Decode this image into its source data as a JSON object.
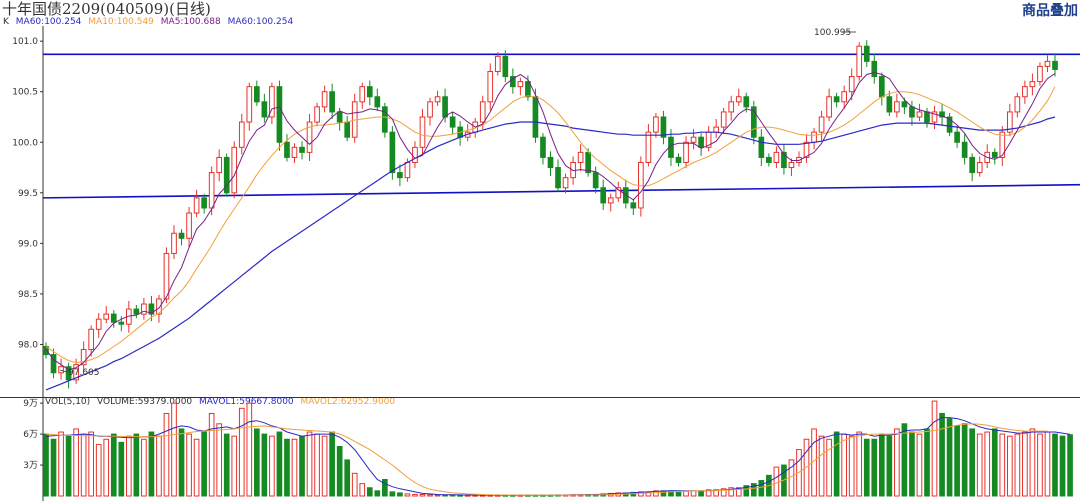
{
  "window": {
    "title": "十年国债2209(040509)(日线)",
    "brand": "商品叠加"
  },
  "colors": {
    "up": "#e8322b",
    "down": "#168a22",
    "ma5": "#7a1e8c",
    "ma10": "#f2a03a",
    "ma60": "#2a2ac8",
    "trendline": "#1010c8",
    "axis": "#333333",
    "grid": "#cccccc"
  },
  "legend": {
    "price": [
      {
        "text": "K",
        "color": "#333333"
      },
      {
        "text": "MA60:100.254",
        "color": "#2a2ac8"
      },
      {
        "text": "MA10:100.549",
        "color": "#f2a03a"
      },
      {
        "text": "MA5:100.688",
        "color": "#7a1e8c"
      },
      {
        "text": "MA60:100.254",
        "color": "#2a2ac8"
      }
    ],
    "volume": [
      {
        "text": "VOL(5,10)",
        "color": "#333333"
      },
      {
        "text": "VOLUME:59379.0000",
        "color": "#333333"
      },
      {
        "text": "MAVOL1:59667.8000",
        "color": "#2a2ac8"
      },
      {
        "text": "MAVOL2:62952.9000",
        "color": "#f2a03a"
      }
    ]
  },
  "annotations": {
    "high": "100.995",
    "low": "97.605"
  },
  "chart_data": [
    {
      "type": "candlestick",
      "ylim": [
        97.5,
        101.15
      ],
      "yticks": [
        "101.0",
        "100.5",
        "100.0",
        "99.5",
        "99.0",
        "98.5",
        "98.0"
      ],
      "ytick_values": [
        101.0,
        100.5,
        100.0,
        99.5,
        99.0,
        98.5,
        98.0
      ],
      "grid": false,
      "trendlines": [
        {
          "start": 100.87,
          "end": 100.87
        },
        {
          "start": 99.45,
          "end": 99.58
        }
      ],
      "close": [
        97.9,
        97.72,
        97.78,
        97.65,
        97.8,
        97.95,
        98.15,
        98.25,
        98.3,
        98.22,
        98.2,
        98.35,
        98.3,
        98.4,
        98.3,
        98.45,
        98.9,
        99.1,
        99.05,
        99.3,
        99.45,
        99.35,
        99.7,
        99.85,
        99.5,
        99.95,
        100.2,
        100.55,
        100.4,
        100.25,
        100.55,
        100.0,
        99.85,
        99.95,
        99.9,
        100.2,
        100.35,
        100.5,
        100.3,
        100.2,
        100.05,
        100.4,
        100.55,
        100.45,
        100.35,
        100.1,
        99.7,
        99.65,
        99.8,
        99.95,
        100.25,
        100.4,
        100.45,
        100.25,
        100.15,
        100.05,
        100.1,
        100.2,
        100.4,
        100.7,
        100.85,
        100.65,
        100.55,
        100.6,
        100.45,
        100.05,
        99.85,
        99.75,
        99.55,
        99.65,
        99.8,
        99.9,
        99.7,
        99.55,
        99.4,
        99.45,
        99.55,
        99.4,
        99.35,
        99.8,
        100.1,
        100.25,
        100.05,
        99.85,
        99.8,
        100.0,
        100.05,
        99.95,
        100.1,
        100.15,
        100.3,
        100.4,
        100.45,
        100.35,
        100.05,
        99.85,
        99.8,
        99.9,
        99.75,
        99.8,
        99.85,
        100.0,
        100.1,
        100.25,
        100.45,
        100.4,
        100.5,
        100.65,
        100.95,
        100.8,
        100.65,
        100.45,
        100.3,
        100.4,
        100.35,
        100.25,
        100.3,
        100.2,
        100.3,
        100.25,
        100.1,
        100.0,
        99.85,
        99.7,
        99.8,
        99.9,
        99.85,
        100.1,
        100.3,
        100.45,
        100.55,
        100.6,
        100.75,
        100.8,
        100.72
      ],
      "open": [
        97.98,
        97.9,
        97.72,
        97.78,
        97.65,
        97.8,
        97.95,
        98.15,
        98.25,
        98.3,
        98.22,
        98.2,
        98.35,
        98.3,
        98.4,
        98.3,
        98.45,
        98.9,
        99.1,
        99.05,
        99.3,
        99.45,
        99.35,
        99.7,
        99.85,
        99.5,
        99.95,
        100.2,
        100.55,
        100.4,
        100.25,
        100.55,
        100.0,
        99.85,
        99.95,
        99.9,
        100.2,
        100.35,
        100.5,
        100.3,
        100.2,
        100.05,
        100.4,
        100.55,
        100.45,
        100.35,
        100.1,
        99.7,
        99.65,
        99.8,
        99.95,
        100.25,
        100.4,
        100.45,
        100.25,
        100.15,
        100.05,
        100.1,
        100.2,
        100.4,
        100.7,
        100.85,
        100.65,
        100.55,
        100.6,
        100.45,
        100.05,
        99.85,
        99.75,
        99.55,
        99.65,
        99.8,
        99.9,
        99.7,
        99.55,
        99.4,
        99.45,
        99.55,
        99.4,
        99.35,
        99.8,
        100.1,
        100.25,
        100.05,
        99.85,
        99.8,
        100.0,
        100.05,
        99.95,
        100.1,
        100.15,
        100.3,
        100.4,
        100.45,
        100.35,
        100.05,
        99.85,
        99.8,
        99.9,
        99.75,
        99.8,
        99.85,
        100.0,
        100.1,
        100.25,
        100.45,
        100.4,
        100.5,
        100.65,
        100.95,
        100.8,
        100.65,
        100.45,
        100.3,
        100.4,
        100.35,
        100.25,
        100.3,
        100.2,
        100.3,
        100.25,
        100.1,
        100.0,
        99.85,
        99.7,
        99.8,
        99.9,
        99.85,
        100.1,
        100.3,
        100.45,
        100.55,
        100.6,
        100.75,
        100.8
      ],
      "ma5": [
        97.95,
        97.85,
        97.8,
        97.75,
        97.77,
        97.82,
        97.91,
        98.0,
        98.13,
        98.21,
        98.25,
        98.28,
        98.29,
        98.33,
        98.31,
        98.36,
        98.47,
        98.63,
        98.76,
        98.96,
        99.14,
        99.22,
        99.34,
        99.49,
        99.57,
        99.67,
        99.85,
        100.01,
        100.12,
        100.17,
        100.33,
        100.35,
        100.21,
        100.12,
        100.05,
        99.98,
        100.05,
        100.18,
        100.25,
        100.31,
        100.28,
        100.29,
        100.3,
        100.33,
        100.32,
        100.3,
        100.23,
        100.05,
        99.93,
        99.84,
        99.87,
        100.01,
        100.15,
        100.26,
        100.3,
        100.26,
        100.2,
        100.15,
        100.18,
        100.3,
        100.46,
        100.57,
        100.63,
        100.67,
        100.62,
        100.47,
        100.3,
        100.08,
        99.89,
        99.77,
        99.72,
        99.73,
        99.72,
        99.71,
        99.66,
        99.6,
        99.53,
        99.48,
        99.43,
        99.51,
        99.62,
        99.78,
        99.89,
        99.97,
        99.99,
        99.99,
        99.99,
        99.94,
        99.97,
        100.01,
        100.11,
        100.19,
        100.28,
        100.33,
        100.31,
        100.2,
        100.09,
        99.99,
        99.88,
        99.82,
        99.82,
        99.86,
        99.9,
        99.99,
        100.13,
        100.24,
        100.34,
        100.45,
        100.59,
        100.67,
        100.69,
        100.67,
        100.63,
        100.52,
        100.42,
        100.35,
        100.32,
        100.3,
        100.28,
        100.26,
        100.23,
        100.17,
        100.09,
        99.97,
        99.89,
        99.85,
        99.83,
        99.87,
        99.99,
        100.12,
        100.25,
        100.38,
        100.53,
        100.63,
        100.68
      ],
      "ma10": [
        97.98,
        97.93,
        97.88,
        97.84,
        97.82,
        97.83,
        97.85,
        97.88,
        97.93,
        97.98,
        98.03,
        98.09,
        98.15,
        98.21,
        98.27,
        98.31,
        98.38,
        98.46,
        98.53,
        98.63,
        98.75,
        98.86,
        98.98,
        99.11,
        99.23,
        99.34,
        99.45,
        99.56,
        99.68,
        99.78,
        99.87,
        99.95,
        100.02,
        100.08,
        100.12,
        100.15,
        100.17,
        100.17,
        100.18,
        100.19,
        100.2,
        100.22,
        100.23,
        100.24,
        100.25,
        100.25,
        100.23,
        100.2,
        100.15,
        100.1,
        100.07,
        100.06,
        100.06,
        100.07,
        100.08,
        100.1,
        100.12,
        100.14,
        100.17,
        100.22,
        100.28,
        100.34,
        100.4,
        100.44,
        100.46,
        100.45,
        100.42,
        100.36,
        100.29,
        100.2,
        100.1,
        100.0,
        99.91,
        99.84,
        99.78,
        99.72,
        99.67,
        99.62,
        99.58,
        99.57,
        99.57,
        99.6,
        99.64,
        99.68,
        99.72,
        99.76,
        99.8,
        99.83,
        99.86,
        99.9,
        99.95,
        100.0,
        100.05,
        100.1,
        100.13,
        100.15,
        100.15,
        100.14,
        100.12,
        100.1,
        100.08,
        100.07,
        100.07,
        100.08,
        100.1,
        100.13,
        100.17,
        100.22,
        100.28,
        100.34,
        100.4,
        100.45,
        100.48,
        100.5,
        100.5,
        100.49,
        100.47,
        100.44,
        100.41,
        100.38,
        100.34,
        100.3,
        100.25,
        100.2,
        100.15,
        100.11,
        100.08,
        100.07,
        100.07,
        100.1,
        100.15,
        100.22,
        100.31,
        100.41,
        100.55
      ],
      "ma60": [
        97.55,
        97.58,
        97.61,
        97.64,
        97.67,
        97.7,
        97.73,
        97.76,
        97.79,
        97.83,
        97.86,
        97.9,
        97.94,
        97.98,
        98.02,
        98.06,
        98.11,
        98.16,
        98.21,
        98.26,
        98.32,
        98.38,
        98.44,
        98.5,
        98.56,
        98.62,
        98.68,
        98.74,
        98.8,
        98.86,
        98.92,
        98.97,
        99.02,
        99.07,
        99.12,
        99.17,
        99.22,
        99.27,
        99.32,
        99.37,
        99.42,
        99.47,
        99.52,
        99.57,
        99.62,
        99.67,
        99.72,
        99.76,
        99.8,
        99.84,
        99.88,
        99.92,
        99.96,
        99.99,
        100.02,
        100.05,
        100.08,
        100.1,
        100.12,
        100.14,
        100.16,
        100.18,
        100.19,
        100.2,
        100.2,
        100.2,
        100.19,
        100.18,
        100.17,
        100.16,
        100.14,
        100.13,
        100.12,
        100.11,
        100.1,
        100.09,
        100.08,
        100.08,
        100.07,
        100.07,
        100.07,
        100.07,
        100.07,
        100.08,
        100.08,
        100.09,
        100.09,
        100.1,
        100.1,
        100.1,
        100.09,
        100.08,
        100.06,
        100.04,
        100.02,
        100.0,
        99.99,
        99.98,
        99.98,
        99.98,
        99.98,
        99.99,
        100.0,
        100.01,
        100.03,
        100.05,
        100.07,
        100.09,
        100.11,
        100.13,
        100.15,
        100.17,
        100.18,
        100.19,
        100.19,
        100.19,
        100.19,
        100.19,
        100.18,
        100.17,
        100.16,
        100.15,
        100.14,
        100.13,
        100.12,
        100.12,
        100.12,
        100.12,
        100.13,
        100.14,
        100.16,
        100.18,
        100.2,
        100.23,
        100.25
      ]
    },
    {
      "type": "bar",
      "ylim": [
        0,
        95000
      ],
      "yticks": [
        "9万",
        "6万",
        "3万"
      ],
      "ytick_values": [
        90000,
        60000,
        30000
      ],
      "values": [
        60000,
        55000,
        62000,
        58000,
        65000,
        60000,
        62000,
        50000,
        55000,
        60000,
        52000,
        58000,
        60000,
        55000,
        62000,
        58000,
        80000,
        90000,
        65000,
        60000,
        55000,
        62000,
        80000,
        70000,
        60000,
        58000,
        85000,
        90000,
        65000,
        60000,
        58000,
        62000,
        55000,
        55000,
        58000,
        62000,
        60000,
        58000,
        62000,
        48000,
        35000,
        22000,
        12000,
        8000,
        5000,
        16000,
        4000,
        3000,
        2000,
        1500,
        1500,
        1200,
        1000,
        1000,
        1000,
        800,
        800,
        800,
        800,
        800,
        800,
        800,
        800,
        800,
        800,
        800,
        800,
        800,
        1000,
        1000,
        1200,
        1200,
        1500,
        1500,
        2000,
        2500,
        3000,
        3000,
        3500,
        4000,
        4000,
        5000,
        5000,
        5000,
        4500,
        4500,
        5000,
        5000,
        6000,
        6000,
        7000,
        8000,
        8000,
        10000,
        12000,
        15000,
        20000,
        28000,
        30000,
        35000,
        45000,
        55000,
        65000,
        58000,
        55000,
        62000,
        60000,
        58000,
        62000,
        55000,
        55000,
        60000,
        58000,
        65000,
        70000,
        62000,
        60000,
        65000,
        92000,
        80000,
        75000,
        68000,
        70000,
        65000,
        60000,
        62000,
        65000,
        60000,
        58000,
        60000,
        62000,
        65000,
        60000,
        62000,
        60000,
        58000,
        59379
      ],
      "mavol1": [
        58000,
        58500,
        59000,
        59000,
        59500,
        60000,
        59500,
        58000,
        58000,
        57500,
        57000,
        56500,
        57000,
        57500,
        57500,
        60000,
        63000,
        66000,
        68000,
        67000,
        64000,
        63000,
        65000,
        66000,
        67000,
        65000,
        68000,
        72000,
        73000,
        71000,
        68000,
        66000,
        62000,
        60000,
        58000,
        59000,
        60000,
        60000,
        60000,
        57000,
        52000,
        45000,
        35000,
        25000,
        16000,
        12000,
        9000,
        7000,
        5500,
        4000,
        2500,
        2000,
        1500,
        1300,
        1200,
        1100,
        1000,
        950,
        900,
        850,
        820,
        800,
        800,
        800,
        800,
        800,
        820,
        850,
        900,
        950,
        1050,
        1150,
        1300,
        1450,
        1750,
        2100,
        2500,
        2800,
        3200,
        3600,
        4000,
        4500,
        4800,
        5000,
        5000,
        4900,
        4900,
        4900,
        5100,
        5400,
        5800,
        6600,
        7300,
        8300,
        9600,
        11000,
        14000,
        18000,
        23000,
        28000,
        34000,
        43000,
        52000,
        56000,
        58000,
        60000,
        60000,
        59000,
        60000,
        60000,
        58000,
        59000,
        59000,
        60000,
        63000,
        64000,
        64000,
        65000,
        72000,
        76000,
        76000,
        75000,
        73000,
        70000,
        67000,
        65000,
        64000,
        63000,
        62000,
        61000,
        61000,
        62000,
        62000,
        62000,
        62000,
        61000,
        59668
      ],
      "mavol2": [
        60000,
        59500,
        59000,
        58800,
        58600,
        58500,
        58500,
        58300,
        58200,
        58000,
        57800,
        57600,
        57500,
        57500,
        57500,
        57800,
        58500,
        59500,
        60500,
        61500,
        62500,
        63000,
        63500,
        64000,
        64500,
        65000,
        66000,
        67000,
        67500,
        68000,
        67000,
        66000,
        65000,
        64500,
        64000,
        63500,
        63000,
        62500,
        62000,
        60000,
        57000,
        53000,
        49000,
        45000,
        40000,
        35000,
        30000,
        24000,
        18000,
        13000,
        9000,
        6500,
        5000,
        4000,
        3000,
        2500,
        2000,
        1700,
        1500,
        1300,
        1100,
        1000,
        950,
        900,
        870,
        850,
        840,
        840,
        850,
        870,
        900,
        950,
        1000,
        1100,
        1200,
        1400,
        1600,
        1900,
        2200,
        2500,
        2900,
        3300,
        3700,
        4100,
        4400,
        4600,
        4800,
        4900,
        5000,
        5200,
        5500,
        5900,
        6300,
        6800,
        7500,
        8500,
        10000,
        12500,
        15500,
        19000,
        23000,
        28000,
        34000,
        40000,
        45000,
        50000,
        54000,
        57000,
        58500,
        59500,
        60000,
        60000,
        60000,
        60500,
        61000,
        61500,
        62000,
        62500,
        63500,
        65000,
        67000,
        68500,
        69500,
        70000,
        69500,
        68500,
        67000,
        65500,
        64500,
        63500,
        63000,
        62900,
        62950,
        62953
      ]
    }
  ]
}
